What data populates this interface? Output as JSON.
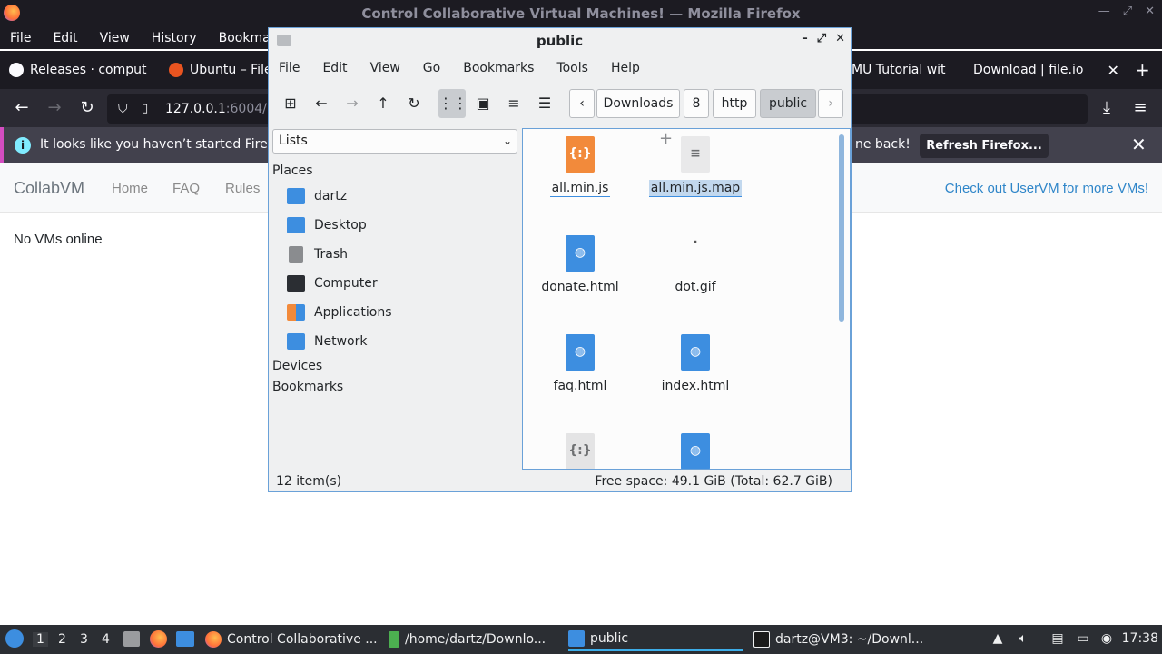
{
  "firefox": {
    "window_title": "Control Collaborative Virtual Machines! — Mozilla Firefox",
    "menu": [
      "File",
      "Edit",
      "View",
      "History",
      "Bookmarks"
    ],
    "tabs": [
      {
        "label": "Releases · comput",
        "icon": "github-icon"
      },
      {
        "label": "Ubuntu – File",
        "icon": "ubuntu-icon"
      },
      {
        "label": "MU Tutorial wit",
        "icon": "page-icon"
      },
      {
        "label": "Download | file.io",
        "icon": "page-icon"
      }
    ],
    "new_tab": "+",
    "url": {
      "host": "127.0.0.1",
      "rest": ":6004/"
    },
    "notice": {
      "text": "It looks like you haven’t started Firefo",
      "text_tail": "ne back!",
      "button": "Refresh Firefox..."
    }
  },
  "page": {
    "brand": "CollabVM",
    "links": [
      "Home",
      "FAQ",
      "Rules"
    ],
    "right_link": "Check out UserVM for more VMs!",
    "body_text": "No VMs online"
  },
  "filemanager": {
    "title": "public",
    "menu": [
      "File",
      "Edit",
      "View",
      "Go",
      "Bookmarks",
      "Tools",
      "Help"
    ],
    "breadcrumbs": [
      "Downloads",
      "8",
      "http",
      "public"
    ],
    "side_combo": "Lists",
    "places_heading": "Places",
    "places": [
      {
        "label": "dartz",
        "icon": "home-folder-icon",
        "color": "#3d8ee0"
      },
      {
        "label": "Desktop",
        "icon": "desktop-icon",
        "color": "#3d8ee0"
      },
      {
        "label": "Trash",
        "icon": "trash-icon",
        "color": "#8a8c8f"
      },
      {
        "label": "Computer",
        "icon": "computer-icon",
        "color": "#2b2e33"
      },
      {
        "label": "Applications",
        "icon": "applications-icon",
        "color": "#f28a3b"
      },
      {
        "label": "Network",
        "icon": "network-folder-icon",
        "color": "#3d8ee0"
      }
    ],
    "devices_heading": "Devices",
    "bookmarks_heading": "Bookmarks",
    "files": [
      {
        "name": "all.min.js",
        "type": "js"
      },
      {
        "name": "all.min.js.map",
        "type": "doc"
      },
      {
        "name": "donate.html",
        "type": "html"
      },
      {
        "name": "dot.gif",
        "type": "image"
      },
      {
        "name": "faq.html",
        "type": "html"
      },
      {
        "name": "index.html",
        "type": "html"
      },
      {
        "name": "",
        "type": "generic"
      },
      {
        "name": "",
        "type": "html"
      }
    ],
    "status_count": "12 item(s)",
    "status_free": "Free space: 49.1 GiB (Total: 62.7 GiB)"
  },
  "taskbar": {
    "workspaces": [
      "1",
      "2",
      "3",
      "4"
    ],
    "tasks": [
      {
        "label": "Control Collaborative ...",
        "icon": "firefox-icon"
      },
      {
        "label": "/home/dartz/Downlo...",
        "icon": "terminal-green-icon"
      },
      {
        "label": "public",
        "icon": "folder-icon"
      },
      {
        "label": "dartz@VM3: ~/Downl...",
        "icon": "terminal-icon"
      }
    ],
    "clock": "17:38"
  }
}
